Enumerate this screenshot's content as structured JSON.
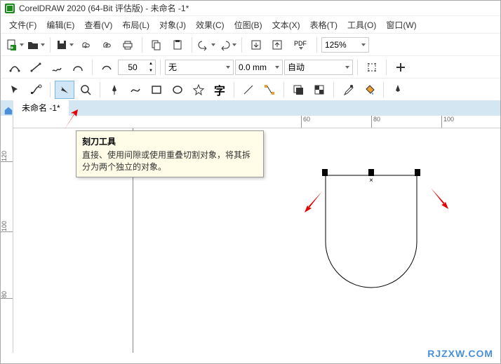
{
  "app": {
    "title": "CorelDRAW 2020 (64-Bit 评估版) - 未命名 -1*"
  },
  "menu": [
    "文件(F)",
    "编辑(E)",
    "查看(V)",
    "布局(L)",
    "对象(J)",
    "效果(C)",
    "位图(B)",
    "文本(X)",
    "表格(T)",
    "工具(O)",
    "窗口(W)"
  ],
  "toolbar1": {
    "zoom": "125%",
    "pdf_label": "PDF"
  },
  "toolbar2": {
    "spin_value": "50",
    "line_style": "无",
    "line_weight": "0.0 mm",
    "combo3": "自动"
  },
  "toolbar3": {
    "text_icon": "字"
  },
  "tabs": {
    "doc": "未命名 -1*"
  },
  "ruler": {
    "h": [
      {
        "v": "60",
        "p": 410
      },
      {
        "v": "80",
        "p": 510
      },
      {
        "v": "100",
        "p": 610
      }
    ],
    "v": [
      {
        "v": "120",
        "p": 50
      },
      {
        "v": "100",
        "p": 150
      },
      {
        "v": "80",
        "p": 250
      }
    ]
  },
  "tooltip": {
    "title": "刻刀工具",
    "body": "直接、使用间隙或使用重叠切割对象，将其拆分为两个独立的对象。"
  },
  "canvas": {
    "sel_center": "×"
  },
  "watermark": "RJZXW.COM"
}
